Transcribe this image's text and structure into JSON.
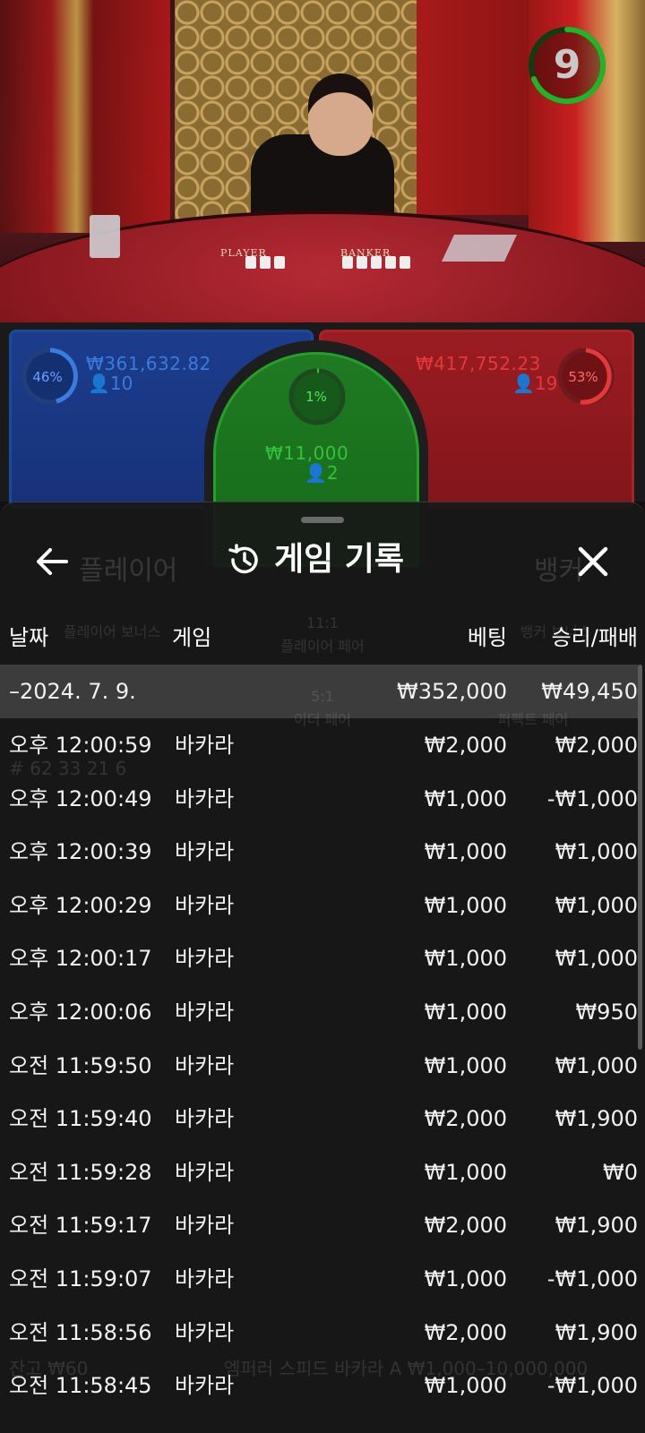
{
  "timer": {
    "value": "9"
  },
  "table": {
    "player_label": "PLAYER",
    "banker_label": "BANKER"
  },
  "bets": {
    "player": {
      "percent": "46%",
      "amount": "₩361,632.82",
      "count": "10"
    },
    "tie": {
      "percent": "1%",
      "amount": "₩11,000",
      "count": "2"
    },
    "banker": {
      "percent": "53%",
      "amount": "₩417,752.23",
      "count": "19"
    }
  },
  "background_ghost": {
    "player": "플레이어",
    "banker": "뱅커",
    "player_bonus": "플레이어 보너스",
    "player_pair_ratio": "11:1",
    "player_pair": "플레이어 페어",
    "either_ratio": "5:1",
    "either_pair": "이더 페어",
    "banker_bonus": "뱅커 보너스",
    "perfect_pair": "퍼펙트 페어",
    "stats": "# 62  33  21  6",
    "balance": "잔고 ₩60",
    "table_name": "엠퍼러 스피드 바카라 A ₩1,000–10,000,000"
  },
  "sheet": {
    "title": "게임 기록",
    "columns": {
      "date": "날짜",
      "game": "게임",
      "bet": "베팅",
      "result": "승리/패배"
    },
    "summary": {
      "date": "–2024. 7. 9.",
      "bet": "₩352,000",
      "result": "₩49,450"
    },
    "rows": [
      {
        "time": "오후 12:00:59",
        "game": "바카라",
        "bet": "₩2,000",
        "result": "₩2,000"
      },
      {
        "time": "오후 12:00:49",
        "game": "바카라",
        "bet": "₩1,000",
        "result": "-₩1,000"
      },
      {
        "time": "오후 12:00:39",
        "game": "바카라",
        "bet": "₩1,000",
        "result": "₩1,000"
      },
      {
        "time": "오후 12:00:29",
        "game": "바카라",
        "bet": "₩1,000",
        "result": "₩1,000"
      },
      {
        "time": "오후 12:00:17",
        "game": "바카라",
        "bet": "₩1,000",
        "result": "₩1,000"
      },
      {
        "time": "오후 12:00:06",
        "game": "바카라",
        "bet": "₩1,000",
        "result": "₩950"
      },
      {
        "time": "오전 11:59:50",
        "game": "바카라",
        "bet": "₩1,000",
        "result": "₩1,000"
      },
      {
        "time": "오전 11:59:40",
        "game": "바카라",
        "bet": "₩2,000",
        "result": "₩1,900"
      },
      {
        "time": "오전 11:59:28",
        "game": "바카라",
        "bet": "₩1,000",
        "result": "₩0"
      },
      {
        "time": "오전 11:59:17",
        "game": "바카라",
        "bet": "₩2,000",
        "result": "₩1,900"
      },
      {
        "time": "오전 11:59:07",
        "game": "바카라",
        "bet": "₩1,000",
        "result": "-₩1,000"
      },
      {
        "time": "오전 11:58:56",
        "game": "바카라",
        "bet": "₩2,000",
        "result": "₩1,900"
      },
      {
        "time": "오전 11:58:45",
        "game": "바카라",
        "bet": "₩1,000",
        "result": "-₩1,000"
      }
    ]
  },
  "colors": {
    "player_blue": "#3b7be0",
    "banker_red": "#e5383b",
    "tie_green": "#34c23a",
    "timer_green": "#1fb52a"
  }
}
